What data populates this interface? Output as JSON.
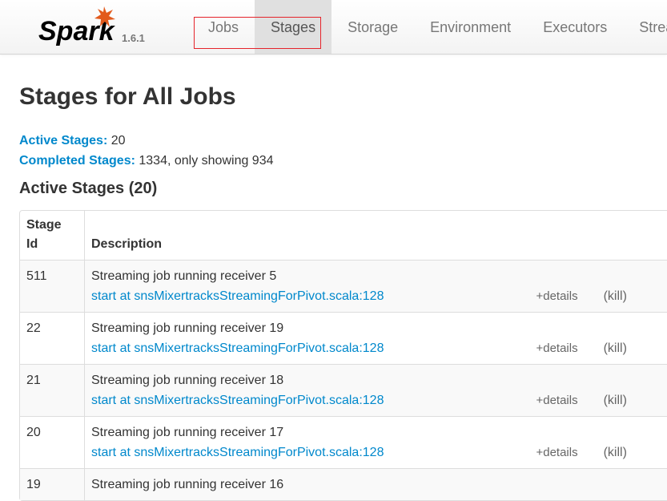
{
  "brand": {
    "name": "Spark",
    "version": "1.6.1"
  },
  "nav": {
    "items": [
      {
        "label": "Jobs"
      },
      {
        "label": "Stages"
      },
      {
        "label": "Storage"
      },
      {
        "label": "Environment"
      },
      {
        "label": "Executors"
      },
      {
        "label": "Strea"
      }
    ],
    "active": "Stages"
  },
  "page": {
    "title": "Stages for All Jobs"
  },
  "summary": {
    "active_label": "Active Stages:",
    "active_value": "20",
    "completed_label": "Completed Stages:",
    "completed_value": "1334, only showing 934"
  },
  "section": {
    "title": "Active Stages (20)"
  },
  "table": {
    "headers": {
      "stage_id_line1": "Stage",
      "stage_id_line2": "Id",
      "description": "Description"
    },
    "rows": [
      {
        "id": "511",
        "desc": "Streaming job running receiver 5",
        "link": "start at snsMixertracksStreamingForPivot.scala:128",
        "details": "+details",
        "kill": "(kill)"
      },
      {
        "id": "22",
        "desc": "Streaming job running receiver 19",
        "link": "start at snsMixertracksStreamingForPivot.scala:128",
        "details": "+details",
        "kill": "(kill)"
      },
      {
        "id": "21",
        "desc": "Streaming job running receiver 18",
        "link": "start at snsMixertracksStreamingForPivot.scala:128",
        "details": "+details",
        "kill": "(kill)"
      },
      {
        "id": "20",
        "desc": "Streaming job running receiver 17",
        "link": "start at snsMixertracksStreamingForPivot.scala:128",
        "details": "+details",
        "kill": "(kill)"
      },
      {
        "id": "19",
        "desc": "Streaming job running receiver 16",
        "link": "",
        "details": "",
        "kill": ""
      }
    ]
  },
  "colors": {
    "link": "#0088cc",
    "highlight_box": "#e5242b",
    "spark_star": "#e25a1c"
  }
}
